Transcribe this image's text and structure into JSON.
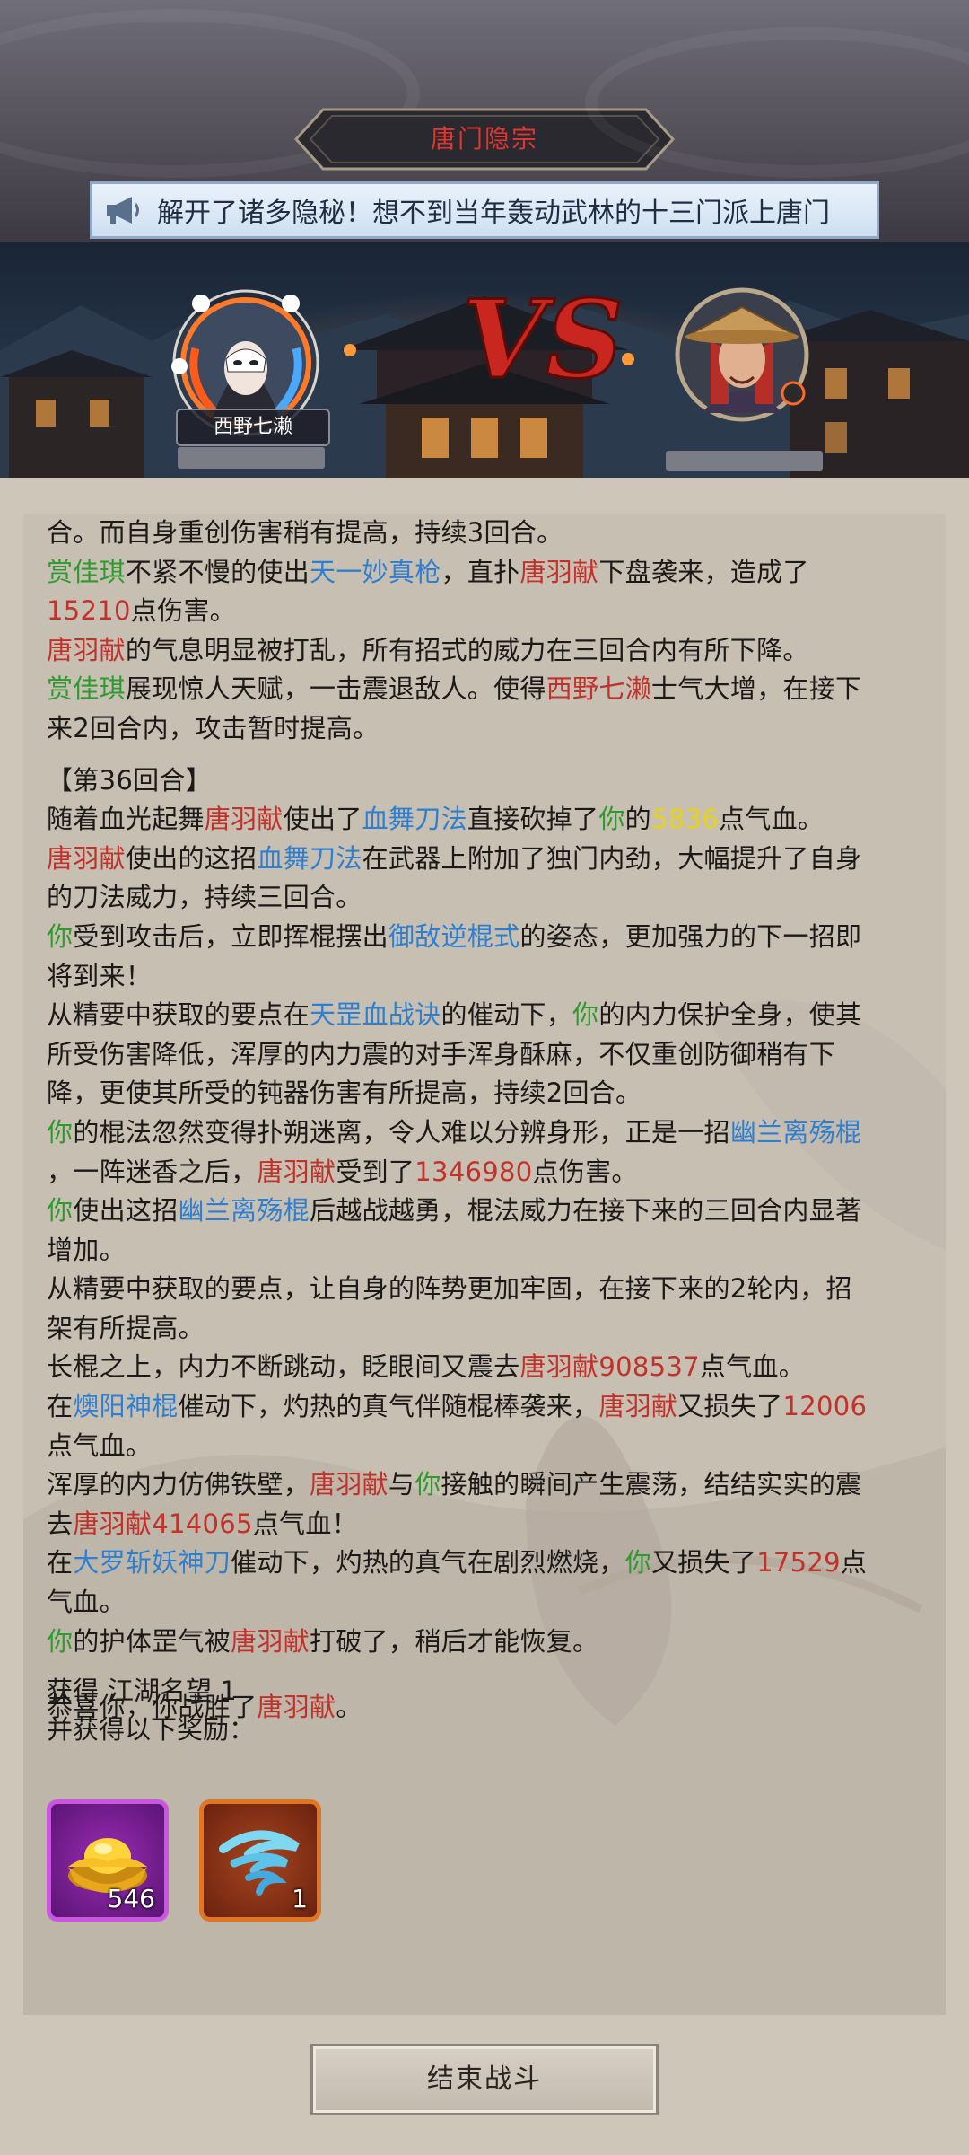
{
  "header": {
    "title": "唐门隐宗",
    "notice": "解开了诸多隐秘！想不到当年轰动武林的十三门派上唐门"
  },
  "battle": {
    "player_name": "西野七濑",
    "vs_text": "VS"
  },
  "log": {
    "l1": "合。而自身重创伤害稍有提高，持续3回合。",
    "l2_a": "赏佳琪",
    "l2_b": "不紧不慢的使出",
    "l2_c": "天一妙真枪",
    "l2_d": "，直扑",
    "l2_e": "唐羽献",
    "l2_f": "下盘袭来，造成了",
    "l3_a": "15210",
    "l3_b": "点伤害。",
    "l4_a": "唐羽献",
    "l4_b": "的气息明显被打乱，所有招式的威力在三回合内有所下降。",
    "l5_a": "赏佳琪",
    "l5_b": "展现惊人天赋，一击震退敌人。使得",
    "l5_c": "西野七濑",
    "l5_d": "士气大增，在接下",
    "l6": "来2回合内，攻击暂时提高。",
    "round": "【第36回合】",
    "l8_a": "随着血光起舞",
    "l8_b": "唐羽献",
    "l8_c": "使出了",
    "l8_d": "血舞刀法",
    "l8_e": "直接砍掉了",
    "l8_f": "你",
    "l8_g": "的",
    "l8_h": "5836",
    "l8_i": "点气血。",
    "l9_a": "唐羽献",
    "l9_b": "使出的这招",
    "l9_c": "血舞刀法",
    "l9_d": "在武器上附加了独门内劲，大幅提升了自身",
    "l10": "的刀法威力，持续三回合。",
    "l11_a": "你",
    "l11_b": "受到攻击后，立即挥棍摆出",
    "l11_c": "御敌逆棍式",
    "l11_d": "的姿态，更加强力的下一招即",
    "l12": "将到来！",
    "l13_a": "从精要中获取的要点在",
    "l13_b": "天罡血战诀",
    "l13_c": "的催动下，",
    "l13_d": "你",
    "l13_e": "的内力保护全身，使其",
    "l14": "所受伤害降低，浑厚的内力震的对手浑身酥麻，不仅重创防御稍有下",
    "l15": "降，更使其所受的钝器伤害有所提高，持续2回合。",
    "l16_a": "你",
    "l16_b": "的棍法忽然变得扑朔迷离，令人难以分辨身形，正是一招",
    "l16_c": "幽兰离殇棍",
    "l17_a": "，一阵迷香之后，",
    "l17_b": "唐羽献",
    "l17_c": "受到了",
    "l17_d": "1346980",
    "l17_e": "点伤害。",
    "l18_a": "你",
    "l18_b": "使出这招",
    "l18_c": "幽兰离殇棍",
    "l18_d": "后越战越勇，棍法威力在接下来的三回合内显著",
    "l19": "增加。",
    "l20": "从精要中获取的要点，让自身的阵势更加牢固，在接下来的2轮内，招",
    "l21": "架有所提高。",
    "l22_a": "长棍之上，内力不断跳动，眨眼间又震去",
    "l22_b": "唐羽献",
    "l22_c": "908537",
    "l22_d": "点气血。",
    "l23_a": "在",
    "l23_b": "燠阳神棍",
    "l23_c": "催动下，灼热的真气伴随棍棒袭来，",
    "l23_d": "唐羽献",
    "l23_e": "又损失了",
    "l23_f": "12006",
    "l24": "点气血。",
    "l25_a": "浑厚的内力仿佛铁壁，",
    "l25_b": "唐羽献",
    "l25_c": "与",
    "l25_d": "你",
    "l25_e": "接触的瞬间产生震荡，结结实实的震",
    "l26_a": "去",
    "l26_b": "唐羽献414065",
    "l26_c": "点气血！",
    "l27_a": "在",
    "l27_b": "大罗斩妖神刀",
    "l27_c": "催动下，灼热的真气在剧烈燃烧，",
    "l27_d": "你",
    "l27_e": "又损失了",
    "l27_f": "17529",
    "l27_g": "点",
    "l28": "气血。",
    "l29_a": "你",
    "l29_b": "的护体罡气被",
    "l29_c": "唐羽献",
    "l29_d": "打破了，稍后才能恢复。",
    "victory_a": "恭喜你，你战胜了",
    "victory_b": "唐羽献",
    "victory_c": "。"
  },
  "reward": {
    "obtain_label": "获得",
    "fame_name": "江湖名望",
    "fame_value": "1",
    "more_label": "并获得以下奖励：",
    "items": [
      {
        "icon": "gold-ingot-icon",
        "count": "546",
        "color": "#9a2cb4"
      },
      {
        "icon": "whirlwind-icon",
        "count": "1",
        "color": "#e17622"
      }
    ]
  },
  "footer": {
    "end_button": "结束战斗"
  }
}
